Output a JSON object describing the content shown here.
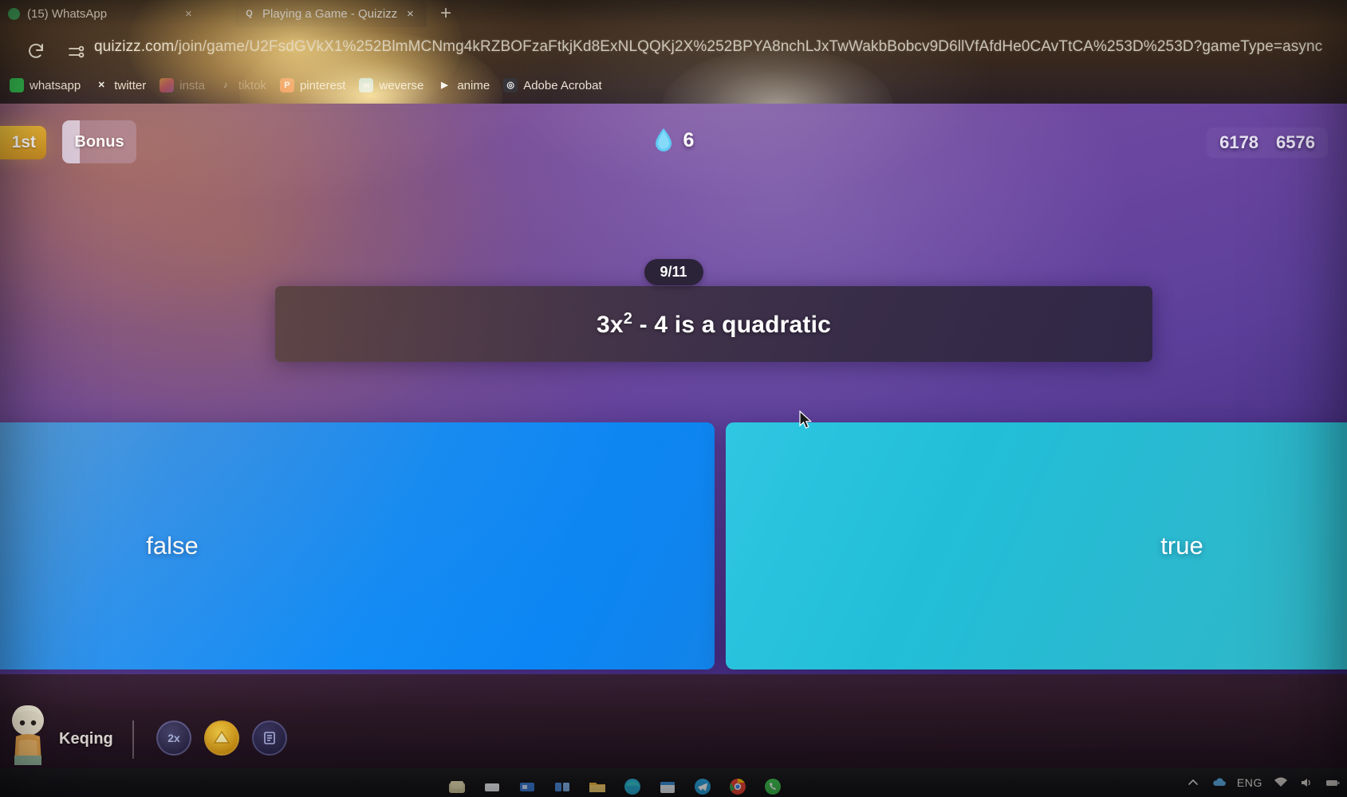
{
  "browser": {
    "tabs": [
      {
        "title": "(15) WhatsApp",
        "favicon": "whatsapp-icon",
        "active": false,
        "close": "×"
      },
      {
        "title": "Playing a Game - Quizizz",
        "favicon": "quizizz-icon",
        "active": true,
        "close": "×"
      }
    ],
    "new_tab_label": "+",
    "reload_label": "↻",
    "url_host": "quizizz.com",
    "url_path": "/join/game/U2FsdGVkX1%252BlmMCNmg4kRZBOFzaFtkjKd8ExNLQQKj2X%252BPYA8nchLJxTwWakbBobcv9D6llVfAfdHe0CAvTtCA%253D%253D?gameType=async",
    "bookmarks": [
      {
        "label": "whatsapp",
        "icon": "whatsapp-icon",
        "glyph": "",
        "dim": false
      },
      {
        "label": "twitter",
        "icon": "twitter-x-icon",
        "glyph": "✕",
        "dim": false
      },
      {
        "label": "insta",
        "icon": "instagram-icon",
        "glyph": "",
        "dim": true
      },
      {
        "label": "tiktok",
        "icon": "tiktok-icon",
        "glyph": "♪",
        "dim": true
      },
      {
        "label": "pinterest",
        "icon": "pinterest-icon",
        "glyph": "P",
        "dim": false
      },
      {
        "label": "weverse",
        "icon": "weverse-icon",
        "glyph": "w",
        "dim": false
      },
      {
        "label": "anime",
        "icon": "play-triangle-icon",
        "glyph": "▶",
        "dim": false
      },
      {
        "label": "Adobe Acrobat",
        "icon": "adobe-acrobat-icon",
        "glyph": "◎",
        "dim": false
      }
    ]
  },
  "quiz": {
    "rank_badge": "1st",
    "bonus_badge": "Bonus",
    "streak_count": "6",
    "streak_icon": "water-drop-icon",
    "scores": [
      "6178",
      "6576"
    ],
    "question_counter": "9/11",
    "question_prefix": "3x",
    "question_exponent": "2",
    "question_suffix": " - 4 is a quadratic",
    "question_full": "3x2 - 4 is a quadratic",
    "answers": [
      {
        "label": "false",
        "color": "#0f8cf8"
      },
      {
        "label": "true",
        "color": "#22bed8"
      }
    ],
    "player_name": "Keqing",
    "powerups": [
      {
        "name": "double-points-powerup",
        "label": "2x"
      },
      {
        "name": "gold-powerup",
        "label": ""
      },
      {
        "name": "blue-powerup",
        "label": ""
      }
    ]
  },
  "taskbar": {
    "language": "ENG",
    "tray_icons": [
      "show-hidden-icons-icon",
      "onedrive-icon",
      "wifi-icon",
      "volume-icon",
      "battery-icon"
    ],
    "app_icons": [
      "start-icon",
      "search-icon",
      "task-view-icon",
      "widgets-icon",
      "file-explorer-icon",
      "edge-icon",
      "store-icon",
      "telegram-icon",
      "chrome-icon",
      "whatsapp-icon"
    ]
  }
}
